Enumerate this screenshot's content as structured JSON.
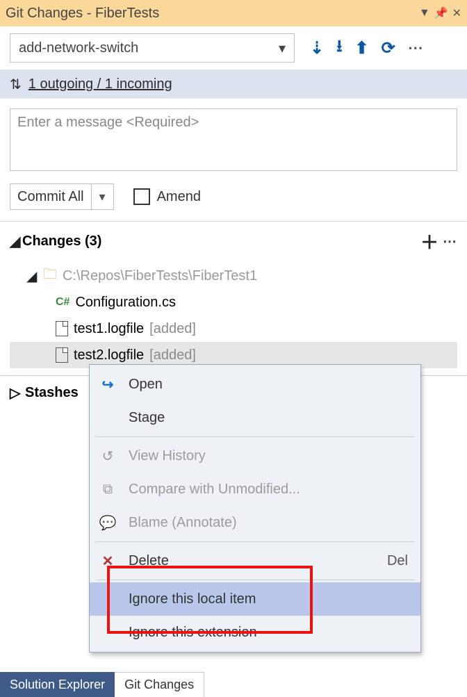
{
  "titlebar": {
    "title": "Git Changes - FiberTests"
  },
  "toolbar": {
    "branch": "add-network-switch"
  },
  "sync": {
    "text": "1 outgoing / 1 incoming"
  },
  "message": {
    "placeholder": "Enter a message <Required>"
  },
  "commit": {
    "label": "Commit All",
    "amend": "Amend"
  },
  "changes": {
    "header": "Changes (3)",
    "folder": "C:\\Repos\\FiberTests\\FiberTest1",
    "files": [
      {
        "name": "Configuration.cs",
        "status": ""
      },
      {
        "name": "test1.logfile",
        "status": "[added]"
      },
      {
        "name": "test2.logfile",
        "status": "[added]"
      }
    ]
  },
  "stashes": {
    "label": "Stashes"
  },
  "context_menu": {
    "items": [
      {
        "label": "Open",
        "enabled": true
      },
      {
        "label": "Stage",
        "enabled": true
      },
      {
        "label": "View History",
        "enabled": false
      },
      {
        "label": "Compare with Unmodified...",
        "enabled": false
      },
      {
        "label": "Blame (Annotate)",
        "enabled": false
      },
      {
        "label": "Delete",
        "enabled": true,
        "shortcut": "Del"
      },
      {
        "label": "Ignore this local item",
        "enabled": true,
        "hover": true
      },
      {
        "label": "Ignore this extension",
        "enabled": true
      }
    ]
  },
  "tabs": {
    "inactive": "Solution Explorer",
    "active": "Git Changes"
  }
}
